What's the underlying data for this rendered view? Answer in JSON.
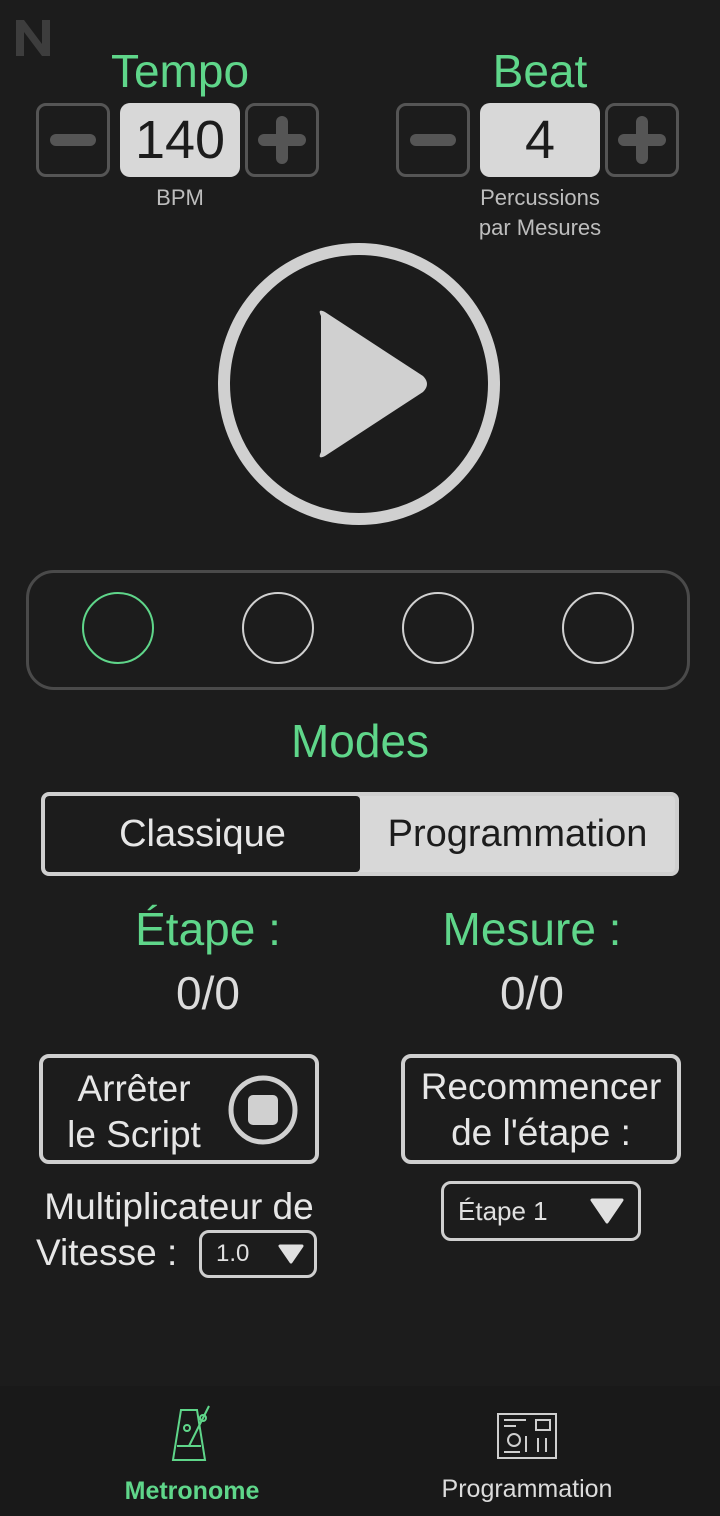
{
  "tempo": {
    "title": "Tempo",
    "value": "140",
    "unit": "BPM"
  },
  "beat": {
    "title": "Beat",
    "value": "4",
    "unit_line1": "Percussions",
    "unit_line2": "par Mesures"
  },
  "beats_indicator": {
    "count": 4,
    "active_index": 0
  },
  "modes": {
    "title": "Modes",
    "options": [
      "Classique",
      "Programmation"
    ],
    "selected": "Programmation"
  },
  "etape": {
    "title": "Étape :",
    "value": "0/0"
  },
  "mesure": {
    "title": "Mesure :",
    "value": "0/0"
  },
  "stop_script": {
    "line1": "Arrêter",
    "line2": "le Script"
  },
  "restart_step": {
    "line1": "Recommencer",
    "line2": "de l'étape :"
  },
  "step_select": {
    "value": "Étape 1"
  },
  "speed": {
    "label_line1": "Multiplicateur de",
    "label_line2": "Vitesse :",
    "value": "1.0"
  },
  "nav": {
    "items": [
      {
        "label": "Metronome",
        "active": true
      },
      {
        "label": "Programmation",
        "active": false
      }
    ]
  },
  "colors": {
    "accent": "#5fd68a",
    "background": "#1c1c1c",
    "light": "#d8d8d8"
  }
}
